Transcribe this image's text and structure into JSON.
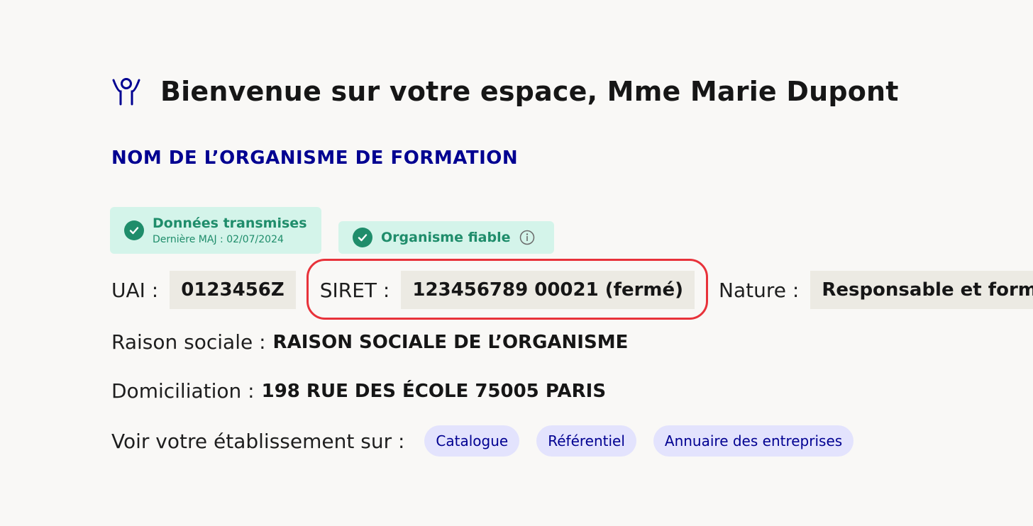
{
  "header": {
    "title": "Bienvenue sur votre espace, Mme Marie Dupont"
  },
  "organism": {
    "name": "NOM DE L’ORGANISME DE FORMATION"
  },
  "badges": {
    "data_sent": {
      "label": "Données transmises",
      "sublabel": "Dernière MAJ : 02/07/2024"
    },
    "reliable": {
      "label": "Organisme fiable"
    }
  },
  "identifiers": {
    "uai_label": "UAI :",
    "uai_value": "0123456Z",
    "siret_label": "SIRET :",
    "siret_value": "123456789 00021 (fermé)",
    "nature_label": "Nature :",
    "nature_value": "Responsable et formateur"
  },
  "raison_sociale": {
    "label": "Raison sociale :",
    "value": "RAISON SOCIALE DE L’ORGANISME"
  },
  "domiciliation": {
    "label": "Domiciliation :",
    "value": "198 RUE DES ÉCOLE 75005 PARIS"
  },
  "links": {
    "label": "Voir votre établissement sur :",
    "items": [
      "Catalogue",
      "Référentiel",
      "Annuaire des entreprises"
    ]
  },
  "colors": {
    "primary": "#000091",
    "success": "#1f8d6b",
    "highlight": "#e8323a"
  },
  "icons": {
    "header": "person-arms-raised-icon",
    "check": "check-circle-icon",
    "info": "info-circle-icon"
  }
}
